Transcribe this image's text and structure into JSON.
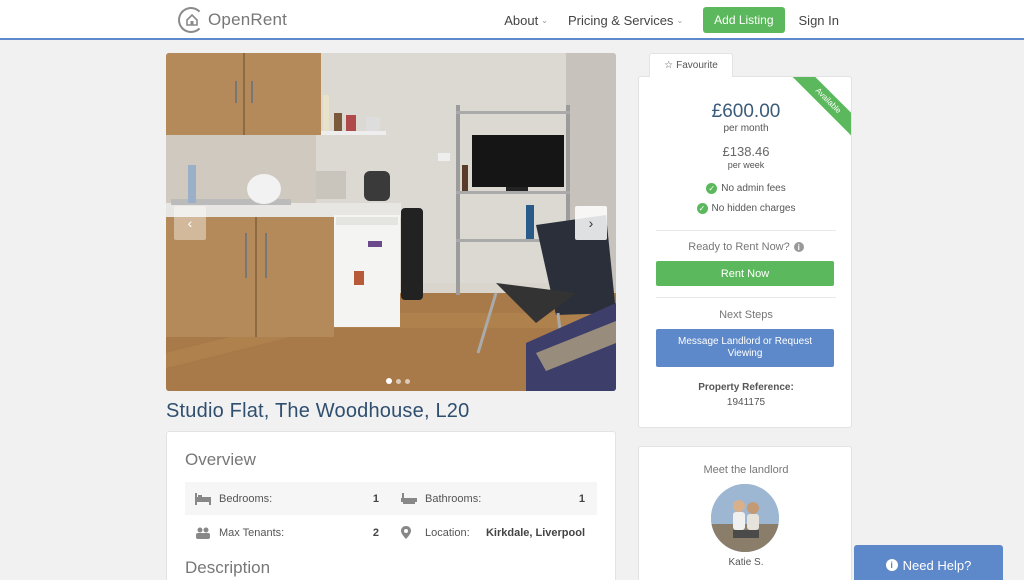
{
  "header": {
    "logo_text": "OpenRent",
    "nav": {
      "about": "About",
      "pricing": "Pricing & Services",
      "add_listing": "Add Listing",
      "sign_in": "Sign In"
    }
  },
  "listing": {
    "title": "Studio Flat, The Woodhouse, L20",
    "gallery": {
      "photo_count_dots": 3,
      "active_index": 0
    }
  },
  "overview": {
    "heading": "Overview",
    "rows": [
      [
        {
          "label": "Bedrooms:",
          "value": "1"
        },
        {
          "label": "Bathrooms:",
          "value": "1"
        }
      ],
      [
        {
          "label": "Max Tenants:",
          "value": "2"
        },
        {
          "label": "Location:",
          "value": "Kirkdale, Liverpool"
        }
      ]
    ],
    "description_heading": "Description"
  },
  "price_card": {
    "favourite": "Favourite",
    "ribbon": "Available",
    "price_month": "£600.00",
    "per_month": "per month",
    "price_week": "£138.46",
    "per_week": "per week",
    "features": [
      "No admin fees",
      "No hidden charges"
    ],
    "ready_label": "Ready to Rent Now?",
    "rent_now": "Rent Now",
    "next_steps": "Next Steps",
    "message_button": "Message Landlord or Request Viewing",
    "ref_label": "Property Reference:",
    "ref_value": "1941175"
  },
  "landlord": {
    "heading": "Meet the landlord",
    "name": "Katie S."
  },
  "help": {
    "label": "Need Help?"
  },
  "colors": {
    "brand_blue": "#5d88c9",
    "green": "#5cb85c",
    "title_blue": "#2f4f6f"
  }
}
